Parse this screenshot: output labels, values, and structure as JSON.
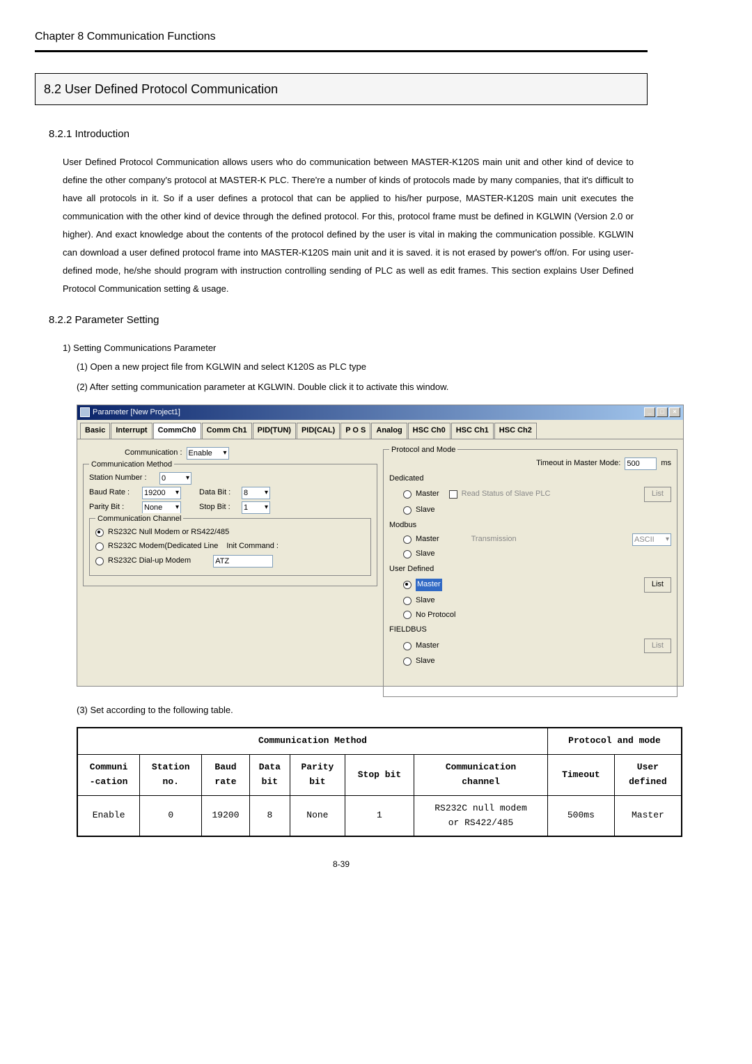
{
  "chapter_header": "Chapter 8   Communication Functions",
  "section_title": "8.2 User Defined Protocol Communication",
  "subsection1_title": "8.2.1 Introduction",
  "intro_paragraph": "User Defined Protocol Communication allows users who do communication between MASTER-K120S main unit and other kind of device to define the other company's protocol at MASTER-K PLC. There're a number of kinds of protocols made by many companies, that it's difficult to have all protocols in it. So if a user defines a protocol that can be applied to his/her purpose, MASTER-K120S main unit executes the communication with the other kind of device through the defined protocol. For this, protocol frame must be defined in KGLWIN (Version 2.0 or higher). And exact knowledge about the contents of the protocol defined by the user is vital in making the communication possible. KGLWIN can download a user defined protocol frame into MASTER-K120S main unit and it is saved. it is not erased by power's off/on. For using user-defined mode, he/she should program with instruction controlling sending of PLC as well as edit frames. This section explains User Defined Protocol Communication setting & usage.",
  "subsection2_title": "8.2.2 Parameter Setting",
  "step1": "1) Setting Communications Parameter",
  "substep1": "(1)   Open a new project file from KGLWIN and select K120S as PLC type",
  "substep2": "(2)   After setting communication parameter at KGLWIN. Double click it to activate this window.",
  "substep3": "(3)   Set according to the following table.",
  "dialog": {
    "title": "Parameter [New Project1]",
    "tabs": [
      "Basic",
      "Interrupt",
      "CommCh0",
      "Comm Ch1",
      "PID(TUN)",
      "PID(CAL)",
      "P O S",
      "Analog",
      "HSC Ch0",
      "HSC Ch1",
      "HSC Ch2"
    ],
    "active_tab_index": 2,
    "left": {
      "communication_label": "Communication :",
      "communication_value": "Enable",
      "group1_title": "Communication Method",
      "station_number_label": "Station Number :",
      "station_number_value": "0",
      "baud_rate_label": "Baud Rate :",
      "baud_rate_value": "19200",
      "data_bit_label": "Data Bit :",
      "data_bit_value": "8",
      "parity_bit_label": "Parity Bit :",
      "parity_bit_value": "None",
      "stop_bit_label": "Stop Bit :",
      "stop_bit_value": "1",
      "group2_title": "Communication Channel",
      "radio1": "RS232C Null Modem or RS422/485",
      "radio2": "RS232C Modem(Dedicated Line",
      "radio3": "RS232C Dial-up Modem",
      "init_command_label": "Init Command :",
      "init_command_value": "ATZ"
    },
    "right": {
      "group_title": "Protocol and Mode",
      "timeout_label": "Timeout in Master Mode:",
      "timeout_value": "500",
      "timeout_unit": "ms",
      "dedicated_label": "Dedicated",
      "dedicated_master": "Master",
      "dedicated_read_status": "Read Status of Slave PLC",
      "dedicated_slave": "Slave",
      "dedicated_list": "List",
      "modbus_label": "Modbus",
      "modbus_master": "Master",
      "modbus_slave": "Slave",
      "transmission_label": "Transmission",
      "transmission_value": "ASCII",
      "userdefined_label": "User Defined",
      "ud_master": "Master",
      "ud_slave": "Slave",
      "ud_noprotocol": "No Protocol",
      "ud_list": "List",
      "fieldbus_label": "FIELDBUS",
      "fb_master": "Master",
      "fb_slave": "Slave",
      "fb_list": "List"
    }
  },
  "table": {
    "header_group1": "Communication Method",
    "header_group2": "Protocol and mode",
    "headers": [
      "Communi\n-cation",
      "Station\nno.",
      "Baud\nrate",
      "Data\nbit",
      "Parity\nbit",
      "Stop bit",
      "Communication\nchannel",
      "Timeout",
      "User\ndefined"
    ],
    "row": [
      "Enable",
      "0",
      "19200",
      "8",
      "None",
      "1",
      "RS232C null modem\nor RS422/485",
      "500ms",
      "Master"
    ]
  },
  "page_number": "8-39"
}
